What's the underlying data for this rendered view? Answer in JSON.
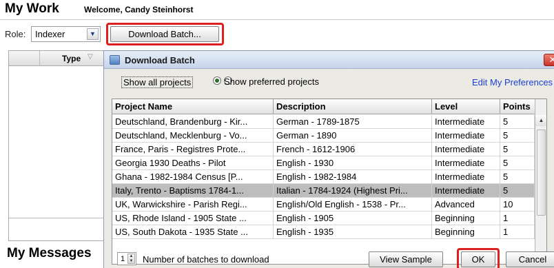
{
  "header": {
    "title": "My Work",
    "welcome": "Welcome, Candy Steinhorst"
  },
  "role": {
    "label": "Role:",
    "value": "Indexer",
    "arrow": "chevron-down-icon"
  },
  "download_button_label": "Download Batch...",
  "left_panel": {
    "type_header": "Type",
    "sort_glyph": "▽"
  },
  "my_messages": "My Messages",
  "dialog": {
    "title": "Download Batch",
    "close_glyph": "✕",
    "options": {
      "show_all": "Show all projects",
      "show_preferred": "Show preferred projects",
      "selected": "show_preferred"
    },
    "edit_preferences": "Edit My Preferences",
    "columns": [
      "Project Name",
      "Description",
      "Level",
      "Points"
    ],
    "rows": [
      {
        "name": "Deutschland, Brandenburg - Kir...",
        "desc": "German - 1789-1875",
        "level": "Intermediate",
        "points": "5"
      },
      {
        "name": "Deutschland, Mecklenburg - Vo...",
        "desc": "German - 1890",
        "level": "Intermediate",
        "points": "5"
      },
      {
        "name": "France, Paris - Registres Prote...",
        "desc": "French - 1612-1906",
        "level": "Intermediate",
        "points": "5"
      },
      {
        "name": "Georgia 1930 Deaths - Pilot",
        "desc": "English - 1930",
        "level": "Intermediate",
        "points": "5"
      },
      {
        "name": "Ghana - 1982-1984 Census [P...",
        "desc": "English - 1982-1984",
        "level": "Intermediate",
        "points": "5"
      },
      {
        "name": "Italy, Trento - Baptisms 1784-1...",
        "desc": "Italian - 1784-1924 (Highest Pri...",
        "level": "Intermediate",
        "points": "5",
        "selected": true
      },
      {
        "name": "UK, Warwickshire - Parish Regi...",
        "desc": "English/Old English - 1538 - Pr...",
        "level": "Advanced",
        "points": "10"
      },
      {
        "name": "US, Rhode Island - 1905 State ...",
        "desc": "English - 1905",
        "level": "Beginning",
        "points": "1"
      },
      {
        "name": "US, South Dakota - 1935 State ...",
        "desc": "English - 1935",
        "level": "Beginning",
        "points": "1"
      }
    ],
    "batch_count": "1",
    "batch_label": "Number of batches to download",
    "view_sample": "View Sample",
    "ok": "OK",
    "cancel": "Cancel"
  },
  "colors": {
    "highlight_outline": "#dd1f1f",
    "selected_row": "#bdbdbd",
    "link": "#1b3fd6"
  }
}
